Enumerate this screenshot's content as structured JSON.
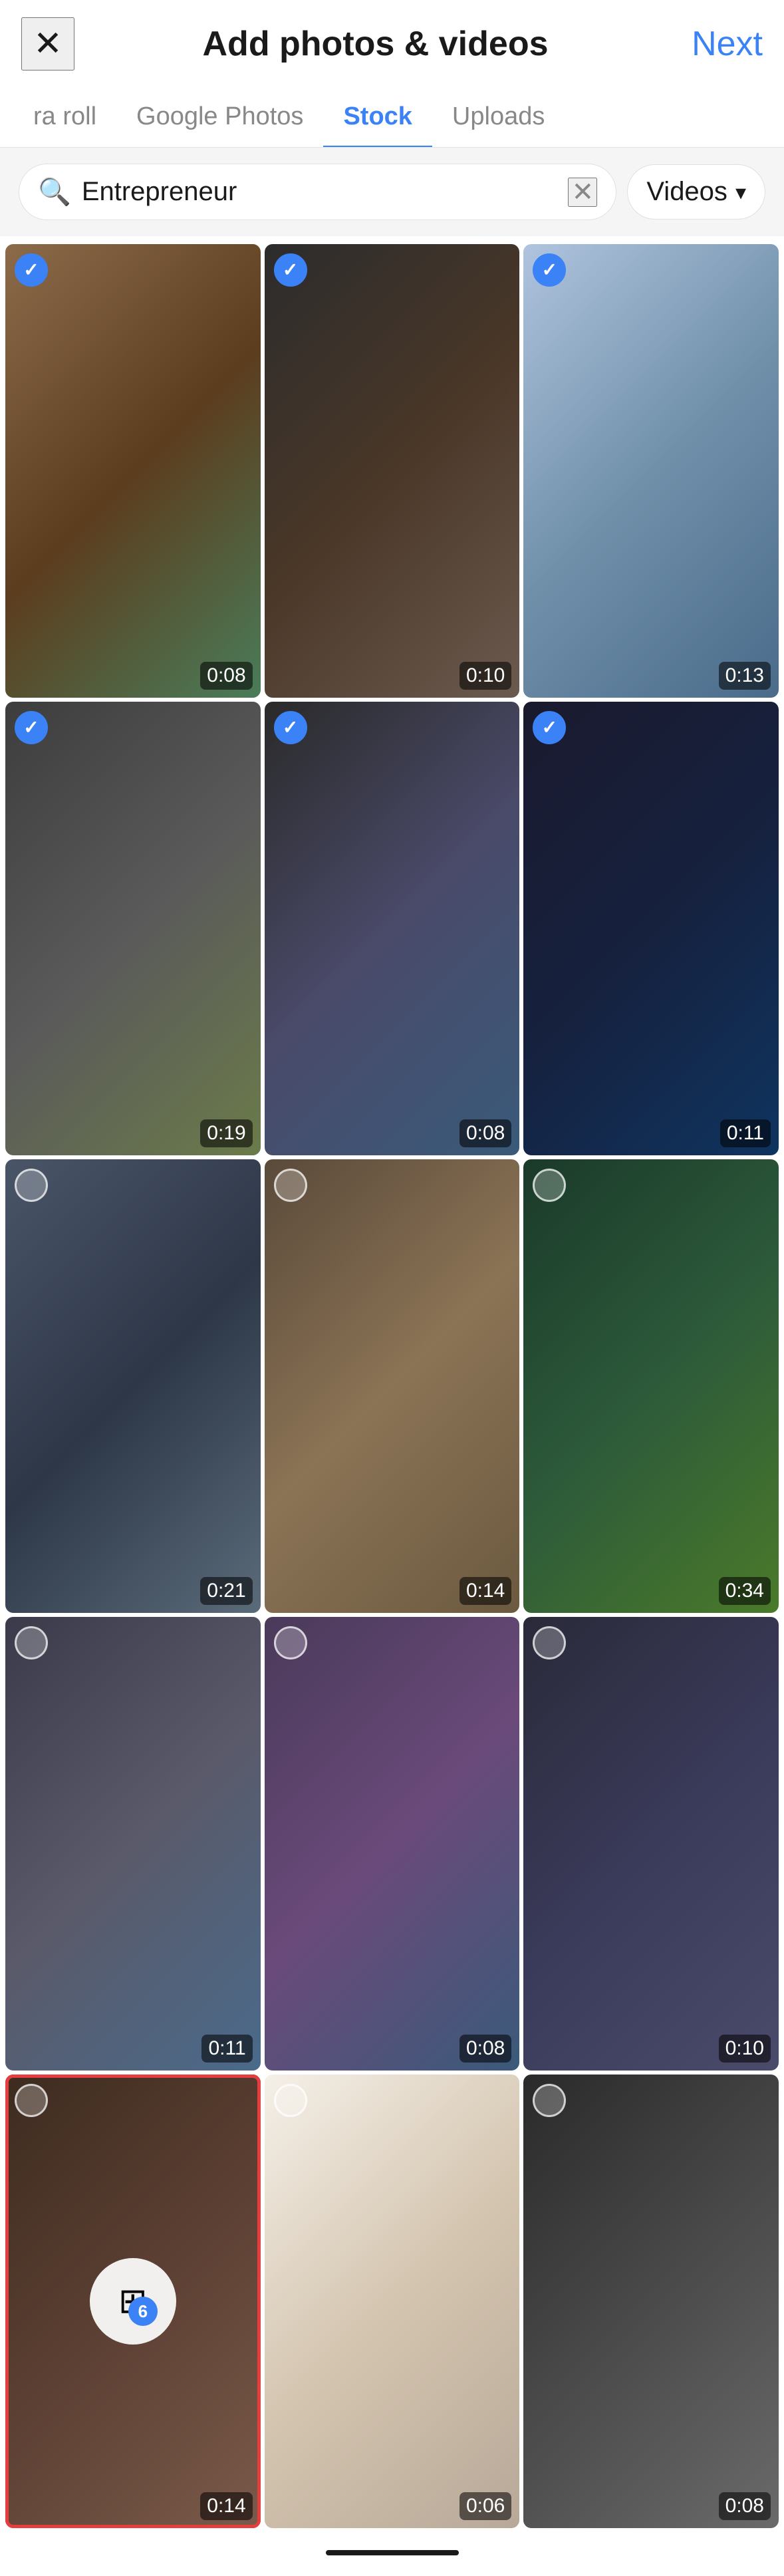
{
  "header": {
    "close_label": "×",
    "title": "Add photos & videos",
    "next_label": "Next"
  },
  "tabs": [
    {
      "id": "camera-roll",
      "label": "ra roll",
      "active": false
    },
    {
      "id": "google-photos",
      "label": "Google Photos",
      "active": false
    },
    {
      "id": "stock",
      "label": "Stock",
      "active": true
    },
    {
      "id": "uploads",
      "label": "Uploads",
      "active": false
    }
  ],
  "search": {
    "query": "Entrepreneur",
    "placeholder": "Search",
    "filter_label": "Videos"
  },
  "grid": {
    "items": [
      {
        "id": 1,
        "duration": "0:08",
        "selected": true,
        "highlighted": false,
        "bg": "bg-1"
      },
      {
        "id": 2,
        "duration": "0:10",
        "selected": true,
        "highlighted": false,
        "bg": "bg-2"
      },
      {
        "id": 3,
        "duration": "0:13",
        "selected": true,
        "highlighted": false,
        "bg": "bg-3"
      },
      {
        "id": 4,
        "duration": "0:19",
        "selected": true,
        "highlighted": false,
        "bg": "bg-4"
      },
      {
        "id": 5,
        "duration": "0:08",
        "selected": true,
        "highlighted": false,
        "bg": "bg-5"
      },
      {
        "id": 6,
        "duration": "0:11",
        "selected": true,
        "highlighted": false,
        "bg": "bg-6"
      },
      {
        "id": 7,
        "duration": "0:21",
        "selected": false,
        "highlighted": false,
        "bg": "bg-7"
      },
      {
        "id": 8,
        "duration": "0:14",
        "selected": false,
        "highlighted": false,
        "bg": "bg-8"
      },
      {
        "id": 9,
        "duration": "0:34",
        "selected": false,
        "highlighted": false,
        "bg": "bg-9"
      },
      {
        "id": 10,
        "duration": "0:11",
        "selected": false,
        "highlighted": false,
        "bg": "bg-10"
      },
      {
        "id": 11,
        "duration": "0:08",
        "selected": false,
        "highlighted": false,
        "bg": "bg-11"
      },
      {
        "id": 12,
        "duration": "0:10",
        "selected": false,
        "highlighted": false,
        "bg": "bg-12"
      },
      {
        "id": 13,
        "duration": "0:14",
        "selected": false,
        "highlighted": true,
        "bg": "bg-13",
        "batch": true,
        "batch_count": "6"
      },
      {
        "id": 14,
        "duration": "0:06",
        "selected": false,
        "highlighted": false,
        "bg": "bg-14"
      },
      {
        "id": 15,
        "duration": "0:08",
        "selected": false,
        "highlighted": false,
        "bg": "bg-15"
      }
    ]
  }
}
